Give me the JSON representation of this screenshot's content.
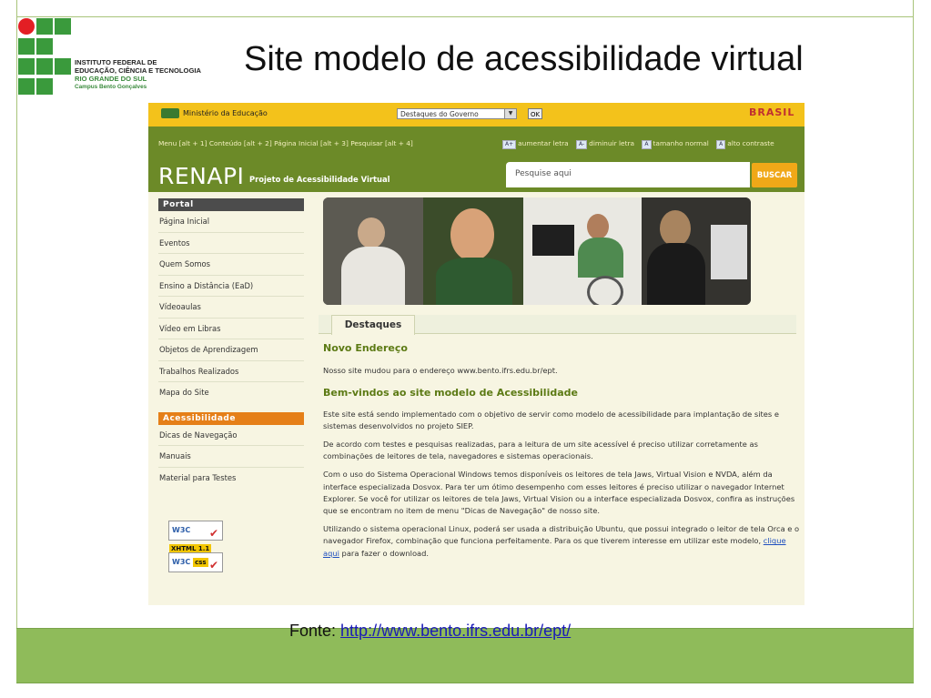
{
  "slide": {
    "title": "Site modelo de acessibilidade virtual",
    "logo": {
      "line1": "INSTITUTO FEDERAL DE",
      "line2": "EDUCAÇÃO, CIÊNCIA E TECNOLOGIA",
      "line3": "RIO GRANDE DO SUL",
      "line4": "Campus Bento Gonçalves"
    },
    "source_label": "Fonte:",
    "source_link": "http://www.bento.ifrs.edu.br/ept/",
    "colors": {
      "green": "#3a9a3c",
      "red": "#e31e24",
      "footer": "#8fbb5a"
    }
  },
  "site": {
    "gov_bar": {
      "ministry": "Ministério da Educação",
      "select_value": "Destaques do Governo",
      "ok_label": "OK",
      "brasil_logo": "BRASIL"
    },
    "shortcuts": "Menu [alt + 1]  Conteúdo [alt + 2]  Página Inicial [alt + 3]  Pesquisar [alt + 4]",
    "font_controls": {
      "increase_key": "A+",
      "increase": "aumentar letra",
      "decrease_key": "A-",
      "decrease": "diminuir letra",
      "normal_key": "A",
      "normal": "tamanho normal",
      "contrast_key": "A",
      "contrast": "alto contraste"
    },
    "brand": "RENAPI",
    "brand_sub": "Projeto de Acessibilidade Virtual",
    "search": {
      "placeholder": "Pesquise aqui",
      "button": "BUSCAR"
    },
    "sidebar": {
      "portal_heading": "Portal",
      "portal_items": [
        "Página Inicial",
        "Eventos",
        "Quem Somos",
        "Ensino a Distância (EaD)",
        "Vídeoaulas",
        "Vídeo em Libras",
        "Objetos de Aprendizagem",
        "Trabalhos Realizados",
        "Mapa do Site"
      ],
      "access_heading": "Acessibilidade",
      "access_items": [
        "Dicas de Navegação",
        "Manuais",
        "Material para Testes"
      ],
      "badge_xhtml_w3c": "W3C",
      "badge_xhtml_tag": "XHTML 1.1",
      "badge_css_w3c": "W3C",
      "badge_css_tag": "css"
    },
    "tab": "Destaques",
    "news_title": "Novo Endereço",
    "news_text": "Nosso site mudou para o endereço www.bento.ifrs.edu.br/ept.",
    "welcome_title": "Bem-vindos ao site modelo de Acessibilidade",
    "p1": "Este site está sendo implementado com o objetivo de servir como modelo de acessibilidade para implantação de sites e sistemas desenvolvidos no projeto SIEP.",
    "p2": "De acordo com testes e pesquisas realizadas, para a leitura de um site acessível é preciso utilizar corretamente as combinações de leitores de tela, navegadores e sistemas operacionais.",
    "p3": "Com o uso do Sistema Operacional Windows temos disponíveis os leitores de tela Jaws, Virtual Vision e NVDA, além da interface especializada Dosvox. Para ter um ótimo desempenho com esses leitores é preciso utilizar o navegador Internet Explorer. Se você for utilizar os leitores de tela Jaws, Virtual Vision ou a interface especializada Dosvox, confira as instruções que se encontram no item de menu \"Dicas de Navegação\" de nosso site.",
    "p4_start": "Utilizando o sistema operacional Linux, poderá ser usada a distribuição Ubuntu, que possui integrado o leitor de tela Orca e o navegador Firefox, combinação que funciona perfeitamente. Para os que tiverem interesse em utilizar este modelo, ",
    "p4_link": "clique aqui",
    "p4_end": " para fazer o download."
  }
}
